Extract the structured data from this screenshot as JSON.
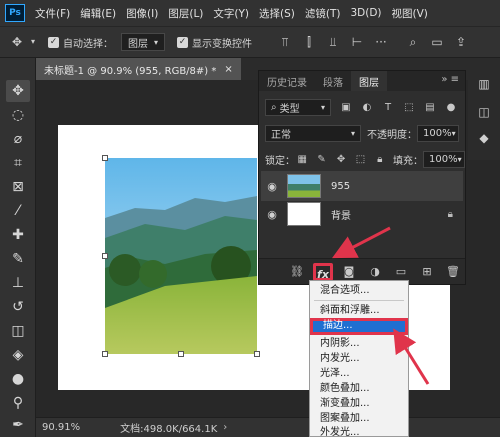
{
  "menubar": {
    "logo": "Ps",
    "items": [
      "文件(F)",
      "编辑(E)",
      "图像(I)",
      "图层(L)",
      "文字(Y)",
      "选择(S)",
      "滤镜(T)",
      "3D(D)",
      "视图(V)"
    ]
  },
  "options": {
    "auto_select_label": "自动选择：",
    "auto_select_value": "图层",
    "show_transform_label": "显示变换控件"
  },
  "document": {
    "tab_title": "未标题-1 @ 90.9% (955, RGB/8#) *",
    "close": "×"
  },
  "status": {
    "zoom": "90.91%",
    "doc_info": "文档:498.0K/664.1K"
  },
  "layers_panel": {
    "tabs": [
      "历史记录",
      "段落",
      "图层"
    ],
    "filter_label": "类型",
    "blend_mode": "正常",
    "opacity_label": "不透明度：",
    "opacity_value": "100%",
    "lock_label": "锁定：",
    "fill_label": "填充：",
    "fill_value": "100%",
    "layers": [
      {
        "name": "955"
      },
      {
        "name": "背景"
      }
    ],
    "fx_label": "fx"
  },
  "context_menu": {
    "items": [
      "混合选项...",
      "斜面和浮雕...",
      "描边...",
      "内阴影...",
      "内发光...",
      "光泽...",
      "颜色叠加...",
      "渐变叠加...",
      "图案叠加...",
      "外发光..."
    ],
    "highlighted_index": 2
  },
  "colors": {
    "annotation": "#e0344b",
    "highlight": "#1f6fd1"
  }
}
